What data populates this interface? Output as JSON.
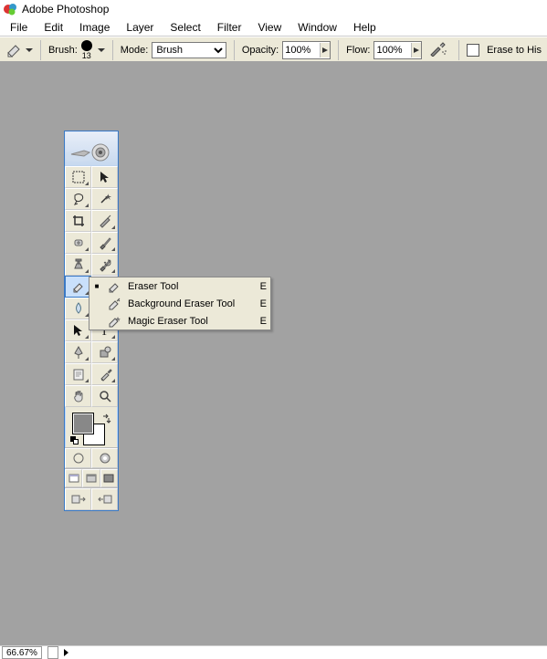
{
  "title": "Adobe Photoshop",
  "menubar": [
    "File",
    "Edit",
    "Image",
    "Layer",
    "Select",
    "Filter",
    "View",
    "Window",
    "Help"
  ],
  "options": {
    "brush_label": "Brush:",
    "brush_size": "13",
    "mode_label": "Mode:",
    "mode_value": "Brush",
    "opacity_label": "Opacity:",
    "opacity_value": "100%",
    "flow_label": "Flow:",
    "flow_value": "100%",
    "erase_history_label": "Erase to His"
  },
  "flyout": [
    {
      "label": "Eraser Tool",
      "key": "E",
      "selected": true
    },
    {
      "label": "Background Eraser Tool",
      "key": "E",
      "selected": false
    },
    {
      "label": "Magic Eraser Tool",
      "key": "E",
      "selected": false
    }
  ],
  "status": {
    "zoom": "66.67%"
  },
  "colors": {
    "fg": "#888888",
    "bg": "#ffffff"
  }
}
